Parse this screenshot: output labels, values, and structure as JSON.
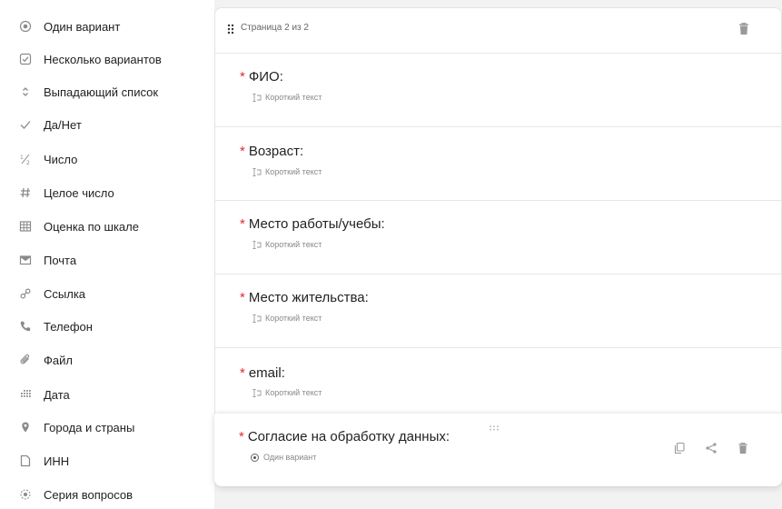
{
  "sidebar": {
    "items": [
      {
        "icon": "radio-icon",
        "label": "Один вариант"
      },
      {
        "icon": "checkbox-icon",
        "label": "Несколько вариантов"
      },
      {
        "icon": "updown-icon",
        "label": "Выпадающий список"
      },
      {
        "icon": "check-icon",
        "label": "Да/Нет"
      },
      {
        "icon": "fraction-icon",
        "label": "Число"
      },
      {
        "icon": "hash-icon",
        "label": "Целое число"
      },
      {
        "icon": "grid-icon",
        "label": "Оценка по шкале"
      },
      {
        "icon": "mail-icon",
        "label": "Почта"
      },
      {
        "icon": "link-icon",
        "label": "Ссылка"
      },
      {
        "icon": "phone-icon",
        "label": "Телефон"
      },
      {
        "icon": "paperclip-icon",
        "label": "Файл"
      },
      {
        "icon": "calendar-icon",
        "label": "Дата"
      },
      {
        "icon": "location-pin-icon",
        "label": "Города и страны"
      },
      {
        "icon": "document-icon",
        "label": "ИНН"
      },
      {
        "icon": "series-icon",
        "label": "Серия вопросов"
      }
    ]
  },
  "page": {
    "label": "Страница 2 из 2"
  },
  "questions": [
    {
      "required_mark": "*",
      "title": "ФИО:",
      "type": "Короткий текст"
    },
    {
      "required_mark": "*",
      "title": "Возраст:",
      "type": "Короткий текст"
    },
    {
      "required_mark": "*",
      "title": "Место работы/учебы:",
      "type": "Короткий текст"
    },
    {
      "required_mark": "*",
      "title": "Место жительства:",
      "type": "Короткий текст"
    },
    {
      "required_mark": "*",
      "title": "email:",
      "type": "Короткий текст"
    }
  ],
  "active_question": {
    "required_mark": "*",
    "title": "Согласие на обработку данных:",
    "type": "Один вариант"
  },
  "colors": {
    "required": "#e02d2d",
    "icon_gray": "#9a9a9a",
    "background": "#f2f2f2"
  }
}
